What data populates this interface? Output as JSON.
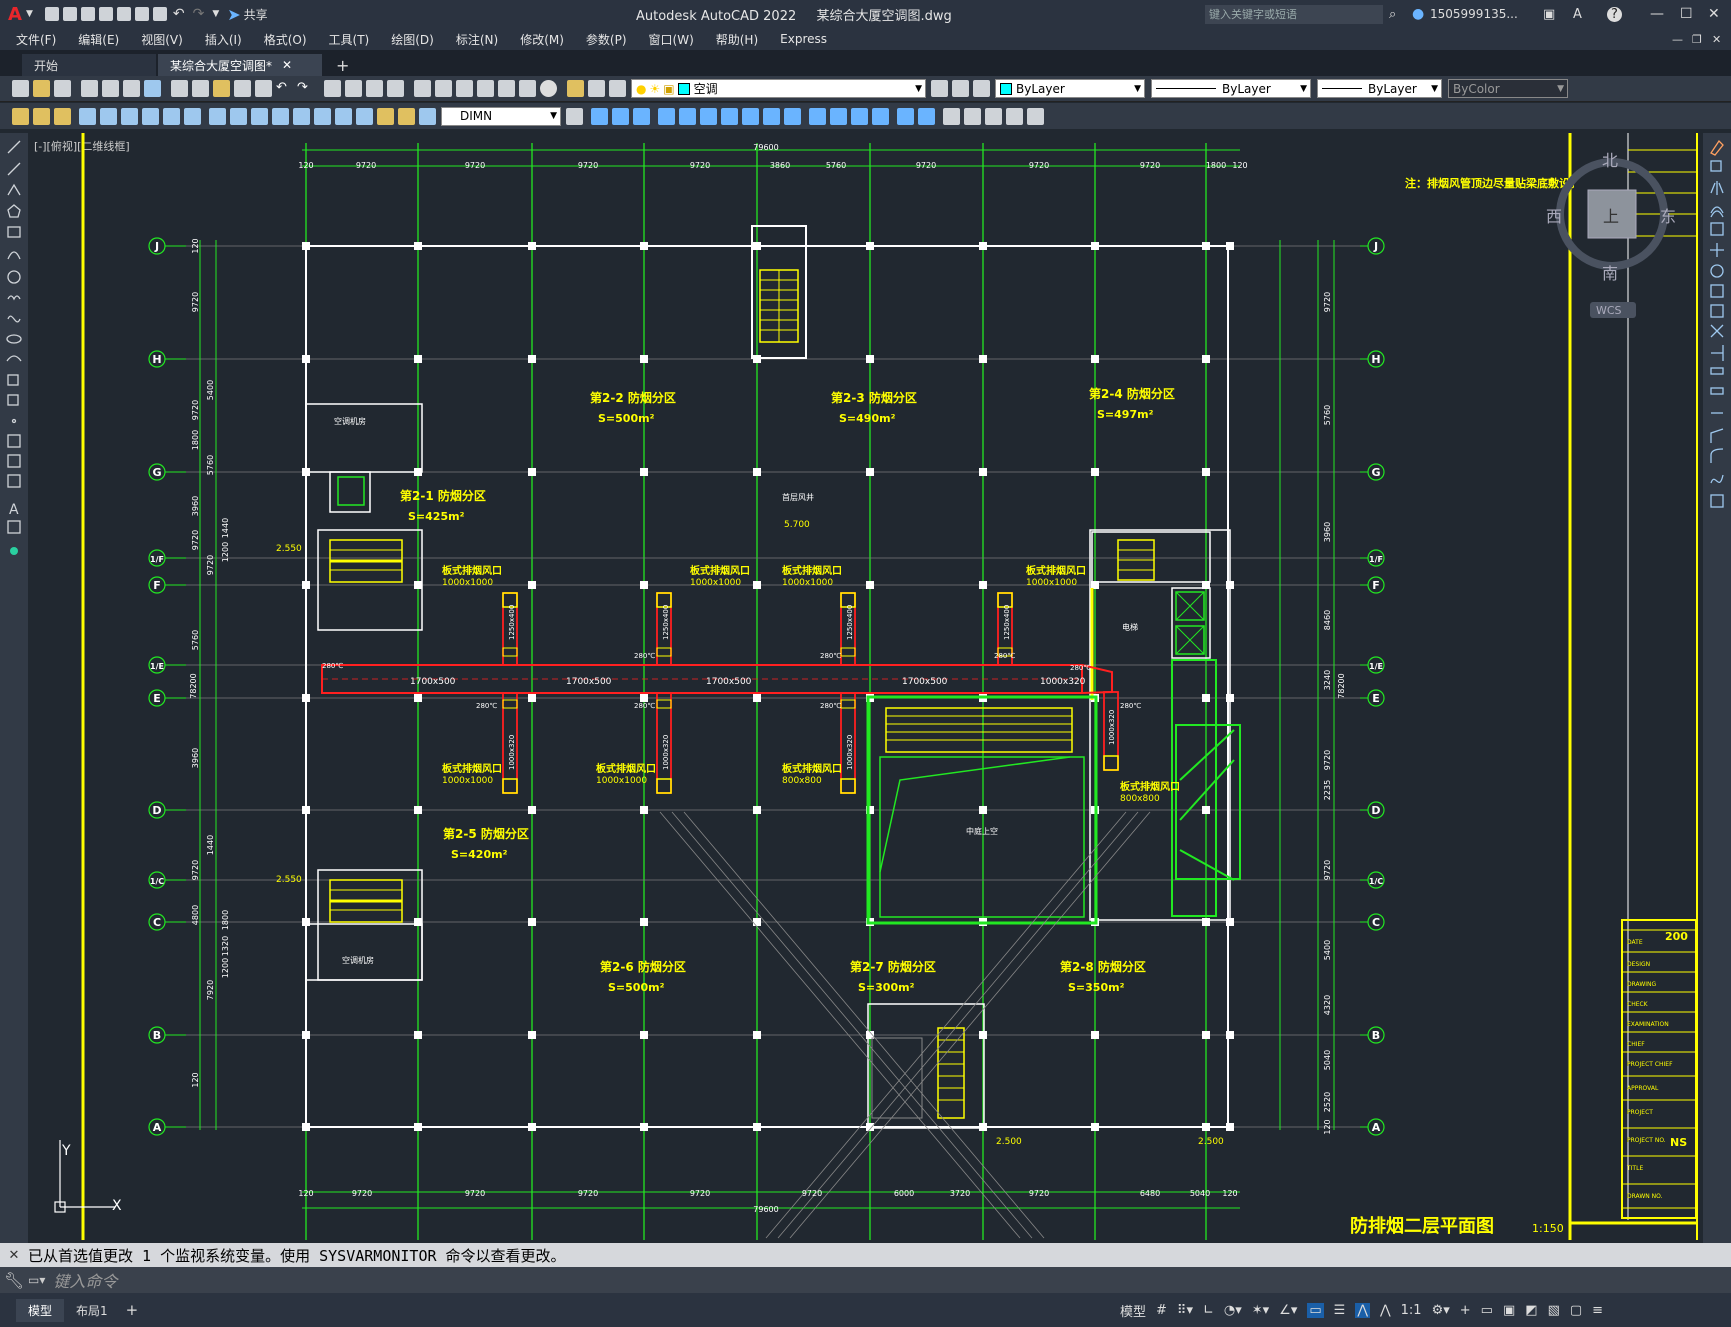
{
  "app": {
    "logo": "A",
    "title": "Autodesk AutoCAD 2022",
    "filename": "某综合大厦空调图.dwg",
    "share_label": "共享",
    "search_placeholder": "键入关键字或短语",
    "user": "1505999135...",
    "help_icon": "?"
  },
  "menu": [
    "文件(F)",
    "编辑(E)",
    "视图(V)",
    "插入(I)",
    "格式(O)",
    "工具(T)",
    "绘图(D)",
    "标注(N)",
    "修改(M)",
    "参数(P)",
    "窗口(W)",
    "帮助(H)",
    "Express"
  ],
  "tabs": [
    {
      "label": "开始",
      "active": false
    },
    {
      "label": "某综合大厦空调图*",
      "active": true
    }
  ],
  "toolbar": {
    "layer": "空调",
    "color": "ByLayer",
    "linetype": "ByLayer",
    "lineweight": "ByLayer",
    "plotstyle": "ByColor",
    "dimstyle": "DIMN"
  },
  "viewport": {
    "label": "[-][俯视][二维线框]",
    "compass": {
      "n": "北",
      "s": "南",
      "e": "东",
      "w": "西",
      "top": "上"
    },
    "wcs": "WCS"
  },
  "drawing": {
    "note": "注：排烟风管顶边尽量贴梁底敷设。",
    "title": "防排烟二层平面图",
    "scale": "1:150",
    "grid_rows": [
      "J",
      "H",
      "G",
      "1/F",
      "F",
      "1/E",
      "E",
      "D",
      "1/C",
      "C",
      "B",
      "A"
    ],
    "top_dims": [
      "120",
      "9720",
      "9720",
      "9720",
      "9720",
      "3860",
      "5760",
      "9720",
      "9720",
      "9720",
      "1800",
      "120"
    ],
    "top_total": "79600",
    "bottom_dims": [
      "120",
      "9720",
      "9720",
      "9720",
      "9720",
      "9720",
      "6000",
      "3720",
      "9720",
      "6480",
      "5040",
      "120"
    ],
    "bottom_total": "79600",
    "left_dims": [
      "120",
      "9720",
      "5400",
      "9720",
      "1800",
      "5760",
      "3960",
      "9720",
      "9720",
      "5760",
      "3960",
      "1440",
      "9720",
      "4800",
      "7920",
      "120"
    ],
    "left_sub": [
      "1800",
      "1320",
      "1200",
      "1440",
      "1200"
    ],
    "right_dims": [
      "9720",
      "5760",
      "3960",
      "8460",
      "3240",
      "9720",
      "2235",
      "9720",
      "5400",
      "4320",
      "5040",
      "2520",
      "120"
    ],
    "total_height": "78200",
    "zones": [
      {
        "name": "第2-1  防烟分区",
        "area": "S=425m²"
      },
      {
        "name": "第2-2  防烟分区",
        "area": "S=500m²"
      },
      {
        "name": "第2-3  防烟分区",
        "area": "S=490m²"
      },
      {
        "name": "第2-4  防烟分区",
        "area": "S=497m²"
      },
      {
        "name": "第2-5  防烟分区",
        "area": "S=420m²"
      },
      {
        "name": "第2-6  防烟分区",
        "area": "S=500m²"
      },
      {
        "name": "第2-7  防烟分区",
        "area": "S=300m²"
      },
      {
        "name": "第2-8  防烟分区",
        "area": "S=350m²"
      }
    ],
    "vent_label": "板式排烟风口",
    "vent_sizes": [
      "1000x1000",
      "1000x1000",
      "1000x1000",
      "1000x1000",
      "1000x1000",
      "1000x1000",
      "800x800",
      "800x800"
    ],
    "duct_sizes": [
      "1700x500",
      "1700x500",
      "1700x500",
      "1700x500",
      "1000x320"
    ],
    "branch_size": "1250x400",
    "branch_size_b": "1000x320",
    "branch_size_c": "1000x320",
    "fire_damper": "280℃",
    "room_labels": [
      "空调机房",
      "空调机房",
      "中庭上空",
      "首层风井",
      "电梯"
    ],
    "elevations": [
      "2.550",
      "5.700",
      "2.550",
      "2.500",
      "2.500"
    ],
    "titleblock": [
      "DATE",
      "DESIGN",
      "DRAWING",
      "CHECK",
      "EXAMINATION",
      "CHIEF",
      "PROJECT CHIEF",
      "APPROVAL",
      "PROJECT",
      "PROJECT NO.",
      "TITLE",
      "DRAWN NO."
    ],
    "tb_date": "200",
    "tb_project": "NS"
  },
  "command": {
    "history": "已从首选值更改 1 个监视系统变量。使用 SYSVARMONITOR 命令以查看更改。",
    "placeholder": "键入命令"
  },
  "layout_tabs": [
    "模型",
    "布局1"
  ],
  "status": {
    "model": "模型",
    "scale": "1:1"
  },
  "colors": {
    "bg": "#212830",
    "green": "#22e822",
    "yellow": "#ffff00",
    "red": "#ff2020",
    "white": "#ffffff",
    "cyan": "#00ffff"
  }
}
